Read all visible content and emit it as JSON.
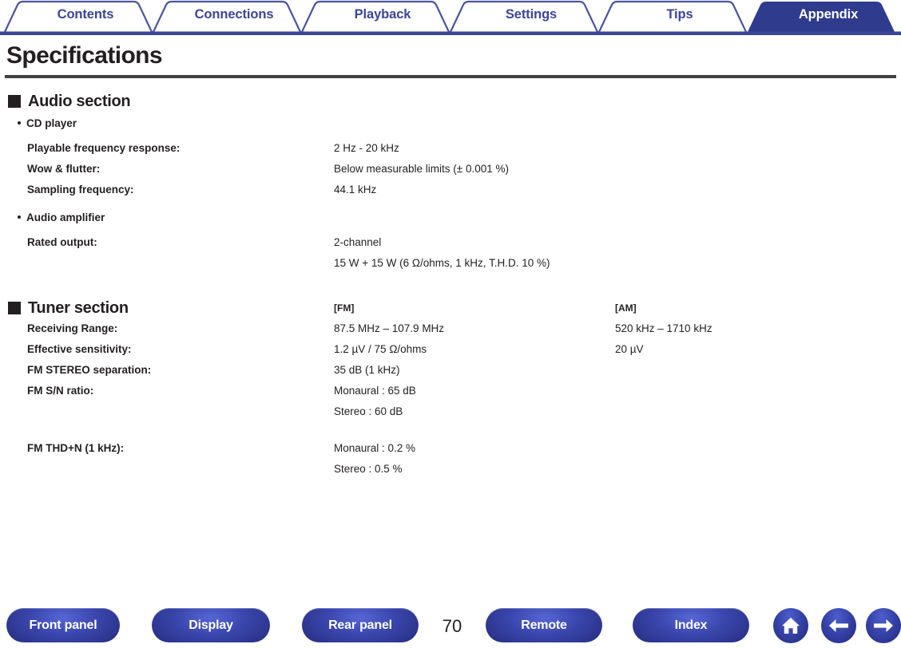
{
  "tabs": [
    {
      "label": "Contents",
      "active": false
    },
    {
      "label": "Connections",
      "active": false
    },
    {
      "label": "Playback",
      "active": false
    },
    {
      "label": "Settings",
      "active": false
    },
    {
      "label": "Tips",
      "active": false
    },
    {
      "label": "Appendix",
      "active": true
    }
  ],
  "page": {
    "title": "Specifications",
    "number": "70"
  },
  "colors": {
    "tab_blue": "#3b4696",
    "tab_active_bg": "#2f3b8c",
    "rule_gray": "#414042",
    "text": "#231f20",
    "pill_blue_light": "#5566d4",
    "pill_blue_dark": "#232a78"
  },
  "sections": [
    {
      "heading": "Audio section",
      "groups": [
        {
          "sub_heading": "CD player",
          "rows": [
            {
              "label": "Playable frequency response:",
              "values": [
                "2 Hz - 20 kHz"
              ]
            },
            {
              "label": "Wow & flutter:",
              "values": [
                "Below measurable limits (± 0.001 %)"
              ]
            },
            {
              "label": "Sampling frequency:",
              "values": [
                "44.1 kHz"
              ]
            }
          ]
        },
        {
          "sub_heading": "Audio amplifier",
          "rows": [
            {
              "label": "Rated output:",
              "values": [
                "2-channel",
                "15 W + 15 W (6 Ω/ohms, 1 kHz, T.H.D. 10 %)"
              ]
            }
          ]
        }
      ]
    },
    {
      "heading": "Tuner section",
      "column_headers": {
        "fm": "[FM]",
        "am": "[AM]"
      },
      "rows": [
        {
          "label": "Receiving Range:",
          "fm": [
            "87.5 MHz – 107.9 MHz"
          ],
          "am": [
            "520 kHz – 1710 kHz"
          ]
        },
        {
          "label": "Effective sensitivity:",
          "fm": [
            "1.2 µV / 75 Ω/ohms"
          ],
          "am": [
            "20 µV"
          ]
        },
        {
          "label": "FM STEREO separation:",
          "fm": [
            "35 dB (1 kHz)"
          ],
          "am": []
        },
        {
          "label": "FM S/N ratio:",
          "fm": [
            "Monaural : 65 dB",
            "Stereo : 60 dB"
          ],
          "am": []
        },
        {
          "label": "FM THD+N (1 kHz):",
          "fm": [
            "Monaural : 0.2 %",
            "Stereo : 0.5 %"
          ],
          "am": []
        }
      ]
    }
  ],
  "footer": {
    "buttons": [
      {
        "label": "Front panel"
      },
      {
        "label": "Display"
      },
      {
        "label": "Rear panel"
      },
      {
        "label": "Remote"
      },
      {
        "label": "Index"
      }
    ],
    "icons": [
      {
        "name": "home-icon"
      },
      {
        "name": "arrow-left-icon"
      },
      {
        "name": "arrow-right-icon"
      }
    ]
  }
}
